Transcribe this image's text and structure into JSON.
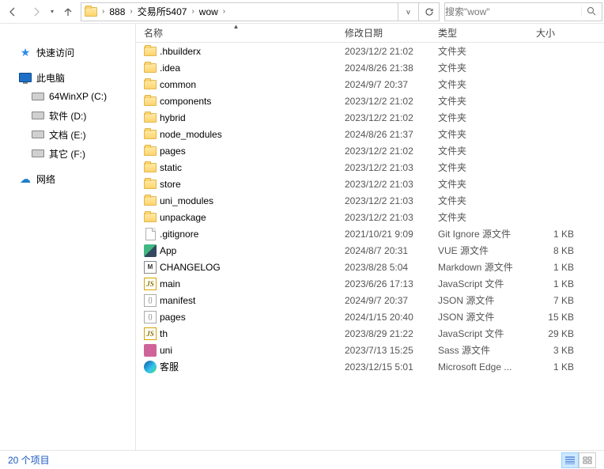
{
  "toolbar": {
    "breadcrumbs": [
      "888",
      "交易所5407",
      "wow"
    ],
    "search_placeholder": "搜索\"wow\""
  },
  "sidebar": {
    "quick_access": "快速访问",
    "this_pc": "此电脑",
    "drives": [
      {
        "label": "64WinXP  (C:)",
        "icon": "drive"
      },
      {
        "label": "软件 (D:)",
        "icon": "drive"
      },
      {
        "label": "文档 (E:)",
        "icon": "drive"
      },
      {
        "label": "其它 (F:)",
        "icon": "drive"
      }
    ],
    "network": "网络"
  },
  "columns": {
    "name": "名称",
    "date": "修改日期",
    "type": "类型",
    "size": "大小"
  },
  "files": [
    {
      "icon": "folder",
      "name": ".hbuilderx",
      "date": "2023/12/2 21:02",
      "type": "文件夹",
      "size": ""
    },
    {
      "icon": "folder",
      "name": ".idea",
      "date": "2024/8/26 21:38",
      "type": "文件夹",
      "size": ""
    },
    {
      "icon": "folder",
      "name": "common",
      "date": "2024/9/7 20:37",
      "type": "文件夹",
      "size": ""
    },
    {
      "icon": "folder",
      "name": "components",
      "date": "2023/12/2 21:02",
      "type": "文件夹",
      "size": ""
    },
    {
      "icon": "folder",
      "name": "hybrid",
      "date": "2023/12/2 21:02",
      "type": "文件夹",
      "size": ""
    },
    {
      "icon": "folder",
      "name": "node_modules",
      "date": "2024/8/26 21:37",
      "type": "文件夹",
      "size": ""
    },
    {
      "icon": "folder",
      "name": "pages",
      "date": "2023/12/2 21:02",
      "type": "文件夹",
      "size": ""
    },
    {
      "icon": "folder",
      "name": "static",
      "date": "2023/12/2 21:03",
      "type": "文件夹",
      "size": ""
    },
    {
      "icon": "folder",
      "name": "store",
      "date": "2023/12/2 21:03",
      "type": "文件夹",
      "size": ""
    },
    {
      "icon": "folder",
      "name": "uni_modules",
      "date": "2023/12/2 21:03",
      "type": "文件夹",
      "size": ""
    },
    {
      "icon": "folder",
      "name": "unpackage",
      "date": "2023/12/2 21:03",
      "type": "文件夹",
      "size": ""
    },
    {
      "icon": "generic",
      "name": ".gitignore",
      "date": "2021/10/21 9:09",
      "type": "Git Ignore 源文件",
      "size": "1 KB"
    },
    {
      "icon": "vue",
      "name": "App",
      "date": "2024/8/7 20:31",
      "type": "VUE 源文件",
      "size": "8 KB"
    },
    {
      "icon": "md",
      "name": "CHANGELOG",
      "date": "2023/8/28 5:04",
      "type": "Markdown 源文件",
      "size": "1 KB"
    },
    {
      "icon": "js",
      "name": "main",
      "date": "2023/6/26 17:13",
      "type": "JavaScript 文件",
      "size": "1 KB"
    },
    {
      "icon": "json",
      "name": "manifest",
      "date": "2024/9/7 20:37",
      "type": "JSON 源文件",
      "size": "7 KB"
    },
    {
      "icon": "json",
      "name": "pages",
      "date": "2024/1/15 20:40",
      "type": "JSON 源文件",
      "size": "15 KB"
    },
    {
      "icon": "js",
      "name": "th",
      "date": "2023/8/29 21:22",
      "type": "JavaScript 文件",
      "size": "29 KB"
    },
    {
      "icon": "sass",
      "name": "uni",
      "date": "2023/7/13 15:25",
      "type": "Sass 源文件",
      "size": "3 KB"
    },
    {
      "icon": "edge",
      "name": "客服",
      "date": "2023/12/15 5:01",
      "type": "Microsoft Edge ...",
      "size": "1 KB"
    }
  ],
  "status": {
    "count": "20 个项目"
  }
}
